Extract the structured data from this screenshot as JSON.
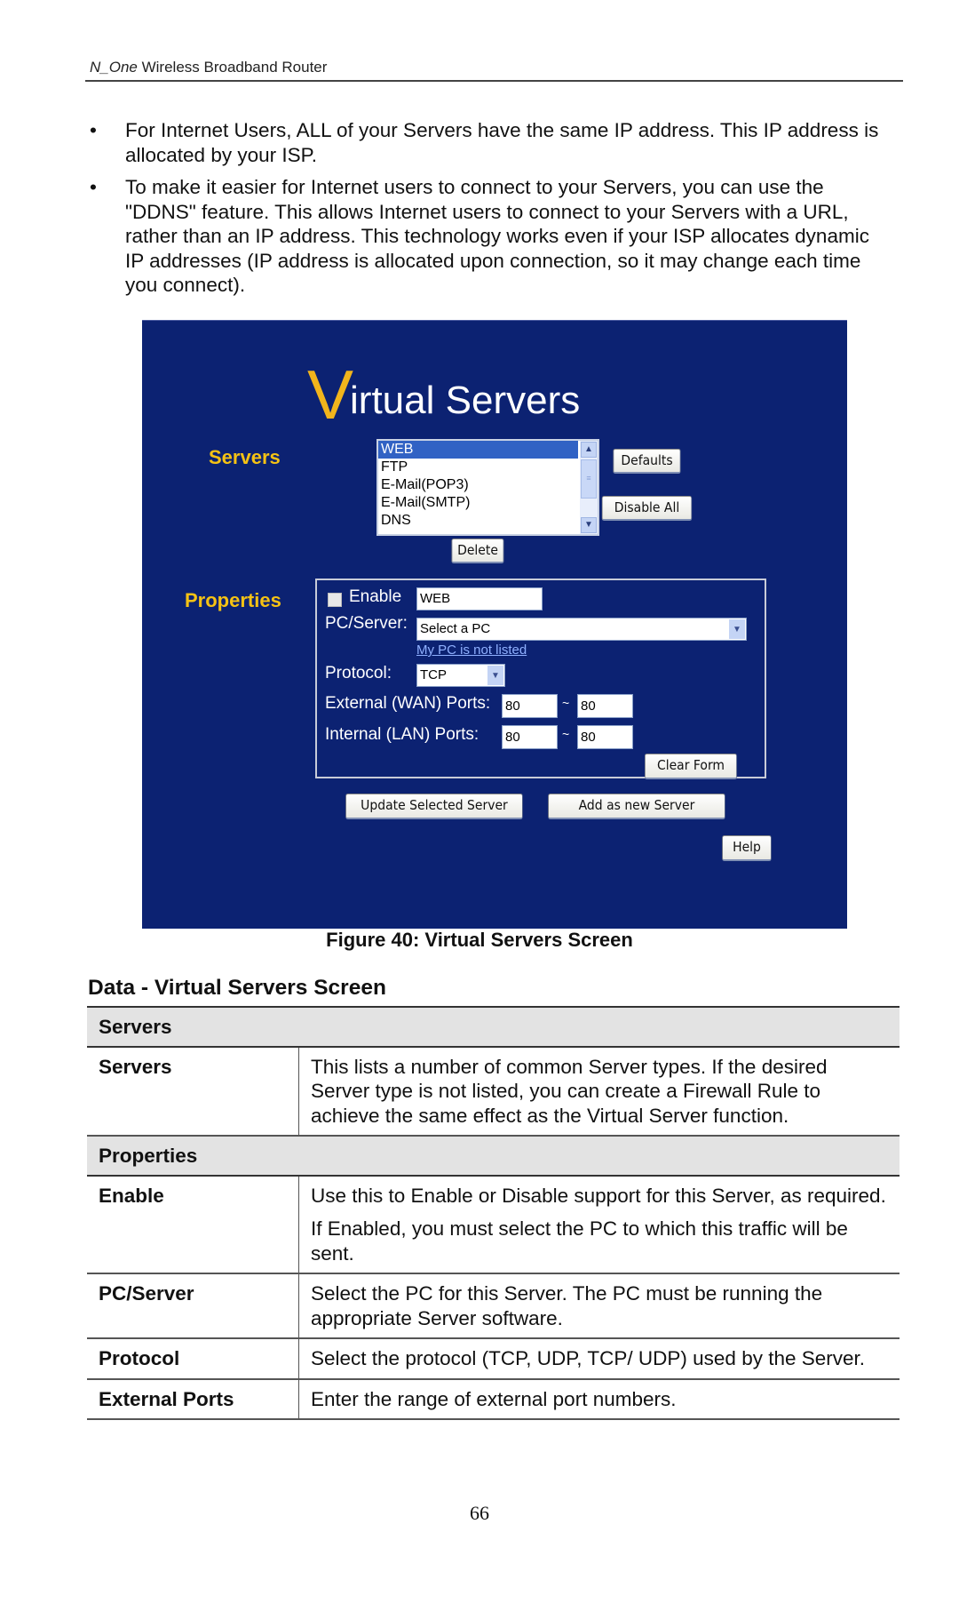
{
  "running_header": {
    "product_italic": "N_One",
    "product_rest": " Wireless Broadband Router"
  },
  "bullets": [
    "For Internet Users, ALL of your Servers have the same IP address. This IP address is allocated by your ISP.",
    "To make it easier for Internet users to connect to your Servers, you can use the \"DDNS\" feature. This allows Internet users to connect to your Servers with a URL, rather than an IP address. This technology works even if your ISP allocates dynamic IP addresses (IP address is allocated upon connection, so it may change each time you connect)."
  ],
  "bullet_glyph": "•",
  "screen": {
    "title_initial": "V",
    "title_rest": "irtual Servers",
    "colors": {
      "background": "#0c2272",
      "label": "#f5c214",
      "title_initial": "#f2b51c",
      "selected": "#3162c4"
    },
    "servers_label": "Servers",
    "server_list": {
      "options": [
        "WEB",
        "FTP",
        "E-Mail(POP3)",
        "E-Mail(SMTP)",
        "DNS"
      ],
      "selected": "WEB",
      "scroll_up_icon": "▲",
      "scroll_down_icon": "▼",
      "thumb_grip": "≡"
    },
    "buttons": {
      "defaults": "Defaults",
      "disable_all": "Disable All",
      "delete": "Delete",
      "clear_form": "Clear Form",
      "update_selected": "Update Selected Server",
      "add_new": "Add as new Server",
      "help": "Help"
    },
    "properties_label": "Properties",
    "form": {
      "enable_label": "Enable",
      "enable_checked": false,
      "name_value": "WEB",
      "pc_server_label": "PC/Server:",
      "pc_server_selected": "Select a PC",
      "pc_not_listed_link": "My PC is not listed",
      "protocol_label": "Protocol:",
      "protocol_selected": "TCP",
      "external_ports_label": "External (WAN) Ports:",
      "external_from": "80",
      "external_to": "80",
      "internal_ports_label": "Internal (LAN) Ports:",
      "internal_from": "80",
      "internal_to": "80",
      "range_separator": "~",
      "dropdown_icon": "▼"
    }
  },
  "figure_caption": "Figure 40: Virtual Servers Screen",
  "section_heading": "Data - Virtual Servers Screen",
  "table": {
    "groups": [
      {
        "title": "Servers",
        "rows": [
          {
            "term": "Servers",
            "desc": [
              "This lists a number of common Server types. If the desired Server type is not listed, you can create a Firewall Rule to achieve the same effect as the Virtual Server function."
            ]
          }
        ]
      },
      {
        "title": "Properties",
        "rows": [
          {
            "term": "Enable",
            "desc": [
              "Use this to Enable or Disable support for this Server, as required.",
              "If Enabled, you must select the PC to which this traffic will be sent."
            ]
          },
          {
            "term": "PC/Server",
            "desc": [
              "Select the PC for this Server. The PC must be running the appropriate Server software."
            ]
          },
          {
            "term": "Protocol",
            "desc": [
              "Select the protocol (TCP, UDP, TCP/ UDP) used by the Server."
            ]
          },
          {
            "term": "External Ports",
            "desc": [
              "Enter the range of external port numbers."
            ]
          }
        ]
      }
    ]
  },
  "page_number": "66"
}
